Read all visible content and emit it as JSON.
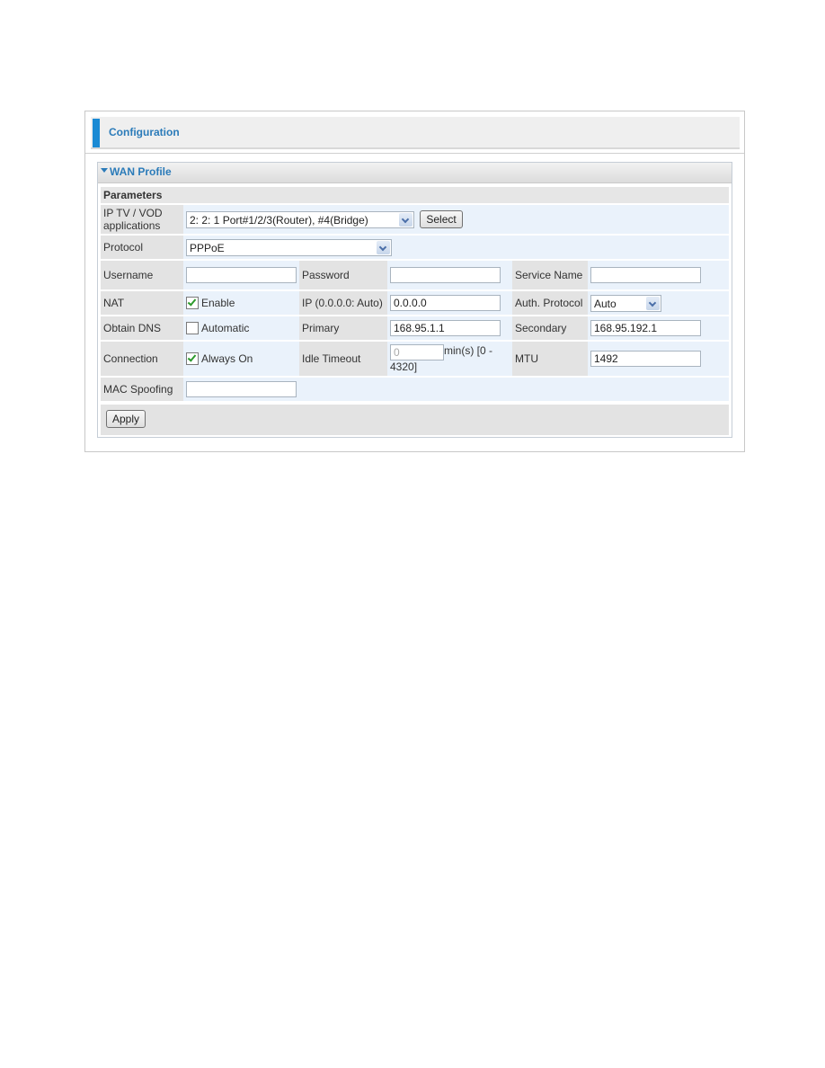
{
  "header": {
    "title": "Configuration"
  },
  "panel": {
    "title": "WAN Profile",
    "section": "Parameters"
  },
  "rows": {
    "iptv": {
      "label": "IP TV / VOD applications",
      "select_value": "2: 2: 1 Port#1/2/3(Router), #4(Bridge)",
      "button": "Select"
    },
    "protocol": {
      "label": "Protocol",
      "select_value": "PPPoE"
    },
    "username": {
      "label": "Username",
      "value": ""
    },
    "password": {
      "label": "Password",
      "value": ""
    },
    "service_name": {
      "label": "Service Name",
      "value": ""
    },
    "nat": {
      "label": "NAT",
      "checkbox_label": "Enable",
      "checked": true
    },
    "ip": {
      "label": "IP (0.0.0.0: Auto)",
      "value": "0.0.0.0"
    },
    "auth_protocol": {
      "label": "Auth. Protocol",
      "select_value": "Auto"
    },
    "obtain_dns": {
      "label": "Obtain DNS",
      "checkbox_label": "Automatic",
      "checked": false
    },
    "primary": {
      "label": "Primary",
      "value": "168.95.1.1"
    },
    "secondary": {
      "label": "Secondary",
      "value": "168.95.192.1"
    },
    "connection": {
      "label": "Connection",
      "checkbox_label": "Always On",
      "checked": true
    },
    "idle_timeout": {
      "label": "Idle Timeout",
      "value": "0",
      "unit": "min(s) [0 - 4320]"
    },
    "mtu": {
      "label": "MTU",
      "value": "1492"
    },
    "mac_spoofing": {
      "label": "MAC Spoofing",
      "value": ""
    }
  },
  "actions": {
    "apply": "Apply"
  },
  "colors": {
    "accent": "#1a8ad4",
    "title_text": "#2b7bb9",
    "label_bg": "#e3e3e3",
    "value_bg": "#eaf2fb"
  }
}
